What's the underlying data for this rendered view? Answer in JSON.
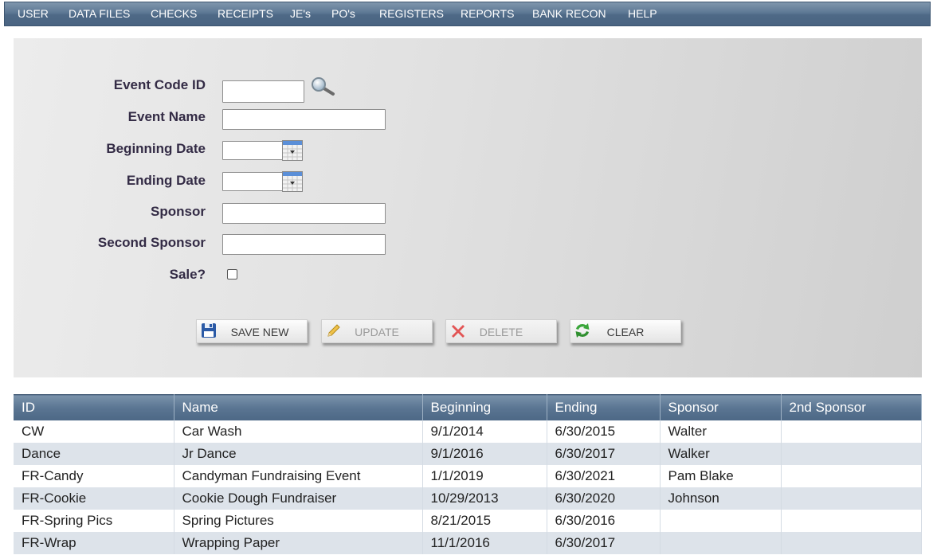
{
  "menu": [
    "USER",
    "DATA FILES",
    "CHECKS",
    "RECEIPTS",
    "JE's",
    "PO's",
    "REGISTERS",
    "REPORTS",
    "BANK RECON",
    "HELP"
  ],
  "form": {
    "event_code_label": "Event Code ID",
    "event_code_value": "",
    "event_name_label": "Event Name",
    "event_name_value": "",
    "beginning_date_label": "Beginning Date",
    "beginning_date_value": "",
    "ending_date_label": "Ending Date",
    "ending_date_value": "",
    "sponsor_label": "Sponsor",
    "sponsor_value": "",
    "second_sponsor_label": "Second Sponsor",
    "second_sponsor_value": "",
    "sale_label": "Sale?",
    "sale_checked": false
  },
  "buttons": {
    "save_new": "SAVE NEW",
    "update": "UPDATE",
    "delete": "DELETE",
    "clear": "CLEAR"
  },
  "table": {
    "columns": [
      "ID",
      "Name",
      "Beginning",
      "Ending",
      "Sponsor",
      "2nd Sponsor"
    ],
    "rows": [
      [
        "CW",
        "Car Wash",
        "9/1/2014",
        "6/30/2015",
        "Walter",
        ""
      ],
      [
        "Dance",
        "Jr Dance",
        "9/1/2016",
        "6/30/2017",
        "Walker",
        ""
      ],
      [
        "FR-Candy",
        "Candyman Fundraising Event",
        "1/1/2019",
        "6/30/2021",
        "Pam Blake",
        ""
      ],
      [
        "FR-Cookie",
        "Cookie Dough Fundraiser",
        "10/29/2013",
        "6/30/2020",
        "Johnson",
        ""
      ],
      [
        "FR-Spring Pics",
        "Spring Pictures",
        "8/21/2015",
        "6/30/2016",
        "",
        ""
      ],
      [
        "FR-Wrap",
        "Wrapping Paper",
        "11/1/2016",
        "6/30/2017",
        "",
        ""
      ]
    ]
  },
  "colors": {
    "menu_bar": "#5d7894",
    "header_bar": "#5a7592",
    "label_text": "#332b45",
    "row_alt": "#dde3ea"
  },
  "icons": {
    "lookup": "magnifier-icon",
    "calendar": "calendar-icon",
    "save": "floppy-disk-icon",
    "update": "pencil-icon",
    "delete": "red-x-icon",
    "clear": "refresh-icon"
  }
}
